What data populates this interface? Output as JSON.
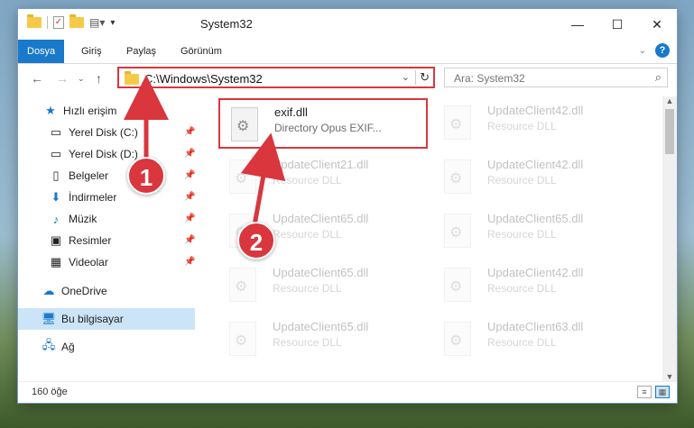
{
  "window": {
    "title": "System32"
  },
  "ribbon": {
    "tabs": [
      "Dosya",
      "Giriş",
      "Paylaş",
      "Görünüm"
    ],
    "help": "?"
  },
  "navigation": {
    "address_path": "C:\\Windows\\System32",
    "search_placeholder": "Ara: System32"
  },
  "sidebar": {
    "items": [
      {
        "label": "Hızlı erişim",
        "icon": "star-icon"
      },
      {
        "label": "Yerel Disk (C:)",
        "icon": "drive-icon",
        "pinned": true
      },
      {
        "label": "Yerel Disk (D:)",
        "icon": "drive-icon",
        "pinned": true
      },
      {
        "label": "Belgeler",
        "icon": "document-icon",
        "pinned": true
      },
      {
        "label": "İndirmeler",
        "icon": "download-icon",
        "pinned": true
      },
      {
        "label": "Müzik",
        "icon": "music-icon",
        "pinned": true
      },
      {
        "label": "Resimler",
        "icon": "picture-icon",
        "pinned": true
      },
      {
        "label": "Videolar",
        "icon": "video-icon",
        "pinned": true
      },
      {
        "label": "OneDrive",
        "icon": "cloud-icon"
      },
      {
        "label": "Bu bilgisayar",
        "icon": "computer-icon",
        "selected": true
      },
      {
        "label": "Ağ",
        "icon": "network-icon"
      }
    ]
  },
  "files": [
    {
      "name": "exif.dll",
      "desc": "Directory Opus EXIF..."
    },
    {
      "name": "UpdateClient42.dll",
      "desc": "Resource DLL"
    },
    {
      "name": "UpdateClient21.dll",
      "desc": "Resource DLL"
    },
    {
      "name": "UpdateClient42.dll",
      "desc": "Resource DLL"
    },
    {
      "name": "UpdateClient65.dll",
      "desc": "Resource DLL"
    },
    {
      "name": "UpdateClient65.dll",
      "desc": "Resource DLL"
    },
    {
      "name": "UpdateClient65.dll",
      "desc": "Resource DLL"
    },
    {
      "name": "UpdateClient42.dll",
      "desc": "Resource DLL"
    },
    {
      "name": "UpdateClient65.dll",
      "desc": "Resource DLL"
    },
    {
      "name": "UpdateClient63.dll",
      "desc": "Resource DLL"
    }
  ],
  "status": {
    "item_count": "160 öğe"
  },
  "annotations": {
    "marker1": "1",
    "marker2": "2"
  },
  "colors": {
    "accent": "#1979ca",
    "highlight": "#d9363e"
  }
}
